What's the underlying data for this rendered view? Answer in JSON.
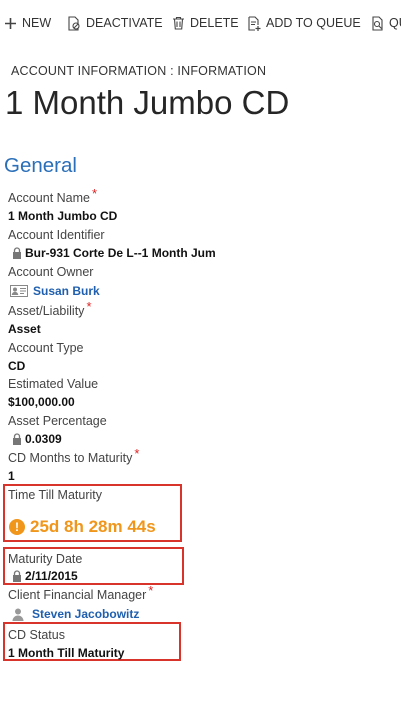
{
  "toolbar": {
    "new": "NEW",
    "deactivate": "DEACTIVATE",
    "delete": "DELETE",
    "add_to_queue": "ADD TO QUEUE",
    "truncated": "QU"
  },
  "breadcrumb": "ACCOUNT INFORMATION : INFORMATION",
  "record_title": "1 Month Jumbo CD",
  "section_title": "General",
  "fields": {
    "account_name": {
      "label": "Account Name",
      "required": "*",
      "value": "1 Month Jumbo CD"
    },
    "account_identifier": {
      "label": "Account Identifier",
      "value": "Bur-931 Corte De L--1 Month Jum"
    },
    "account_owner": {
      "label": "Account Owner",
      "value": "Susan Burk"
    },
    "asset_liability": {
      "label": "Asset/Liability",
      "required": "*",
      "value": "Asset"
    },
    "account_type": {
      "label": "Account Type",
      "value": "CD"
    },
    "estimated_value": {
      "label": "Estimated Value",
      "value": "$100,000.00"
    },
    "asset_percentage": {
      "label": "Asset Percentage",
      "value": "0.0309"
    },
    "cd_months": {
      "label": "CD Months to Maturity",
      "required": "*",
      "value": "1"
    },
    "time_till_maturity": {
      "label": "Time Till Maturity",
      "value": "25d 8h 28m 44s"
    },
    "maturity_date": {
      "label": "Maturity Date",
      "value": "2/11/2015"
    },
    "client_financial_manager": {
      "label": "Client Financial Manager",
      "required": "*",
      "value": "Steven Jacobowitz"
    },
    "cd_status": {
      "label": "CD Status",
      "value": "1 Month Till Maturity"
    }
  },
  "colors": {
    "link": "#1f5fae",
    "section_title": "#2a6fb8",
    "highlight_border": "#d9342b",
    "timer_warning": "#f0961b",
    "required_marker": "#d22222"
  },
  "icons": [
    "plus-icon",
    "deactivate-icon",
    "trash-icon",
    "add-to-queue-icon",
    "queue-icon",
    "lock-icon",
    "user-card-icon",
    "person-icon",
    "warning-icon"
  ]
}
